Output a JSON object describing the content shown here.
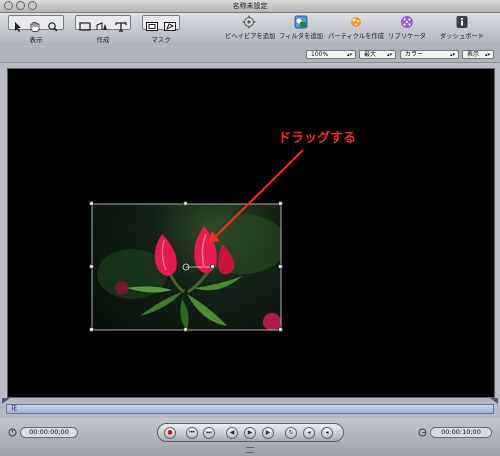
{
  "window": {
    "title": "名称未設定"
  },
  "toolbar": {
    "groups": [
      {
        "label": "表示"
      },
      {
        "label": "作成"
      },
      {
        "label": "マスク"
      }
    ],
    "actions": [
      {
        "label": "ビヘイビアを追加",
        "icon": "gear-icon"
      },
      {
        "label": "フィルタを追加",
        "icon": "filter-icon"
      },
      {
        "label": "パーティクルを作成",
        "icon": "particles-icon"
      },
      {
        "label": "リプリケータ",
        "icon": "replicator-icon"
      },
      {
        "label": "ダッシュボード",
        "icon": "info-icon"
      }
    ]
  },
  "options": {
    "zoom": "100%",
    "quality": "最大",
    "channel": "カラー",
    "view": "表示"
  },
  "canvas": {
    "annotation": "ドラッグする",
    "annotation_color": "#ff2626"
  },
  "timeline": {
    "track_label": "花"
  },
  "transport": {
    "timecode_start": "00:00:00;00",
    "timecode_end": "00:00:10;00"
  }
}
